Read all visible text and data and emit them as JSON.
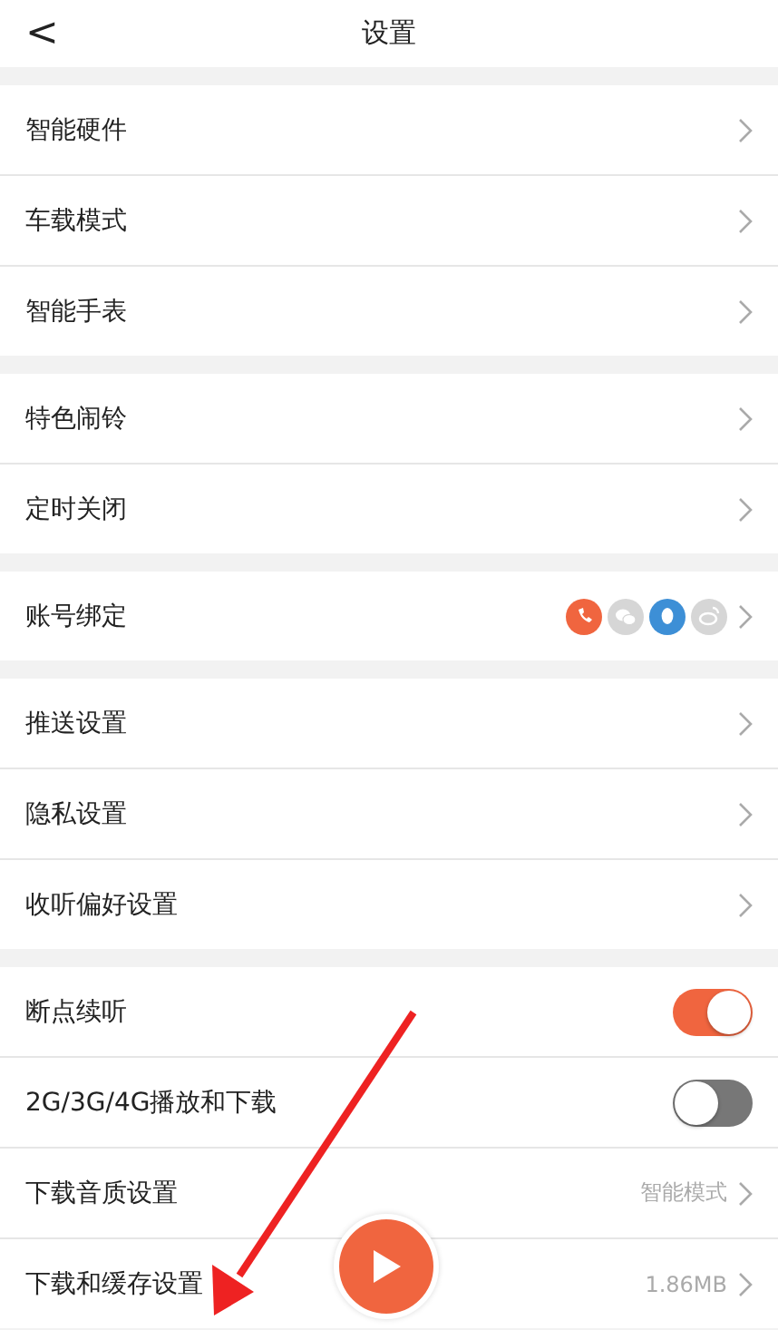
{
  "header": {
    "back": "<",
    "title": "设置"
  },
  "groups": [
    {
      "items": [
        {
          "kind": "link",
          "label": "智能硬件"
        },
        {
          "kind": "link",
          "label": "车载模式"
        },
        {
          "kind": "link",
          "label": "智能手表"
        }
      ]
    },
    {
      "items": [
        {
          "kind": "link",
          "label": "特色闹铃"
        },
        {
          "kind": "link",
          "label": "定时关闭"
        }
      ]
    },
    {
      "items": [
        {
          "kind": "accounts",
          "label": "账号绑定",
          "accounts": [
            {
              "kind": "phone",
              "color": "#f0653f"
            },
            {
              "kind": "chat",
              "color": "#d6d6d6"
            },
            {
              "kind": "penguin",
              "color": "#3d8fd6"
            },
            {
              "kind": "weibo",
              "color": "#d6d6d6"
            }
          ]
        }
      ]
    },
    {
      "items": [
        {
          "kind": "link",
          "label": "推送设置"
        },
        {
          "kind": "link",
          "label": "隐私设置"
        },
        {
          "kind": "link",
          "label": "收听偏好设置"
        }
      ]
    },
    {
      "items": [
        {
          "kind": "toggle",
          "label": "断点续听",
          "on": true
        },
        {
          "kind": "toggle",
          "label": "2G/3G/4G播放和下载",
          "on": false
        },
        {
          "kind": "link",
          "label": "下载音质设置",
          "value": "智能模式"
        },
        {
          "kind": "link",
          "label": "下载和缓存设置",
          "value": "1.86MB"
        }
      ]
    }
  ]
}
